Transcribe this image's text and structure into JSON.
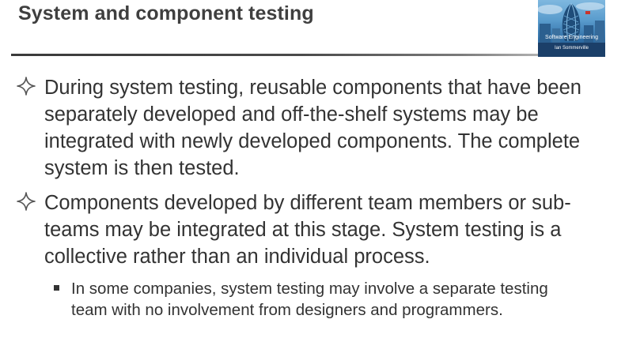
{
  "slide": {
    "title": "System and component testing"
  },
  "book_cover": {
    "title": "Software Engineering",
    "author": "Ian Sommerville"
  },
  "bullets": [
    {
      "icon": "four-point-star-icon",
      "text": "During system testing, reusable components that have been separately developed and off-the-shelf systems may be integrated with newly developed components. The complete system is then tested."
    },
    {
      "icon": "four-point-star-icon",
      "text": "Components developed by different team members or sub-teams may be integrated at this stage. System testing is a collective rather than an individual process."
    }
  ],
  "sub_bullets": [
    {
      "icon": "square-bullet-icon",
      "text": "In some companies, system testing may involve a separate testing team with no involvement from designers and programmers."
    }
  ],
  "colors": {
    "title_text": "#3f3f3f",
    "body_text": "#333333",
    "rule": "#3a3a3a",
    "cover_sky": "#5a9ccd"
  }
}
